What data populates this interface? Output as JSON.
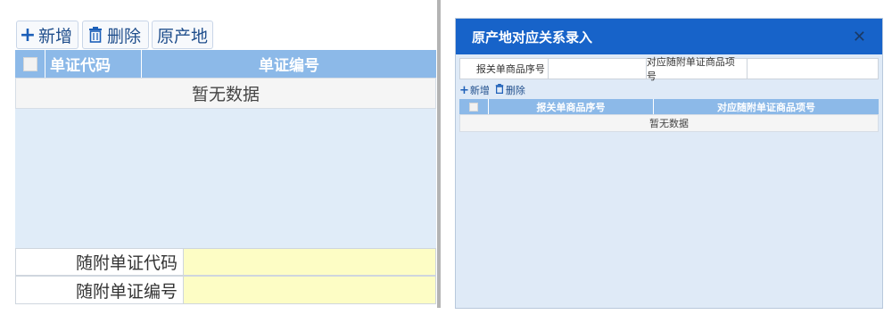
{
  "left": {
    "toolbar": {
      "add_label": "新增",
      "delete_label": "删除",
      "origin_label": "原产地"
    },
    "table": {
      "columns": [
        "单证代码",
        "单证编号"
      ],
      "empty_text": "暂无数据"
    },
    "form": {
      "doc_code_label": "随附单证代码",
      "doc_number_label": "随附单证编号",
      "doc_code_value": "",
      "doc_number_value": ""
    }
  },
  "dialog": {
    "title": "原产地对应关系录入",
    "close_symbol": "✕",
    "fields": {
      "customs_item_seq_label": "报关单商品序号",
      "doc_item_seq_label": "对应随附单证商品项号",
      "customs_item_seq_value": "",
      "doc_item_seq_value": ""
    },
    "toolbar": {
      "add_label": "新增",
      "delete_label": "删除"
    },
    "table": {
      "columns": [
        "报关单商品序号",
        "对应随附单证商品项号"
      ],
      "empty_text": "暂无数据"
    }
  },
  "colors": {
    "header_blue": "#8cb9e8",
    "title_bar_blue": "#1763c9",
    "input_yellow": "#fdfdc5",
    "body_light_blue": "#e0ecf8"
  },
  "icons": {
    "add": "plus-icon",
    "delete": "trash-icon",
    "close": "close-icon",
    "checkbox": "checkbox-icon"
  }
}
